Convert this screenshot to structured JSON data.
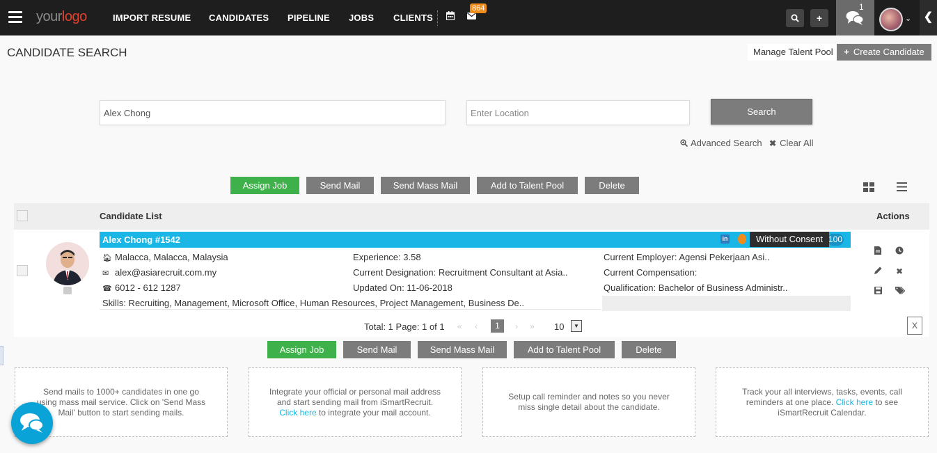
{
  "nav": {
    "logo_a": "your",
    "logo_b": "logo",
    "items": [
      "IMPORT RESUME",
      "CANDIDATES",
      "PIPELINE",
      "JOBS",
      "CLIENTS"
    ],
    "mail_badge": "864",
    "chat_count": "1"
  },
  "header": {
    "title": "CANDIDATE SEARCH",
    "manage_pool": "Manage Talent Pool",
    "create_candidate": "Create Candidate"
  },
  "search": {
    "keyword_value": "Alex Chong",
    "location_placeholder": "Enter Location",
    "button": "Search",
    "advanced": "Advanced Search",
    "clear": "Clear All"
  },
  "actions": {
    "assign_job": "Assign Job",
    "send_mail": "Send Mail",
    "send_mass_mail": "Send Mass Mail",
    "add_pool": "Add to Talent Pool",
    "delete": "Delete"
  },
  "list": {
    "title": "Candidate List",
    "actions_label": "Actions"
  },
  "candidate": {
    "name": "Alex Chong #1542",
    "tooltip": "Without Consent",
    "score": "100",
    "location": "Malacca, Malacca, Malaysia",
    "email": "alex@asiarecruit.com.my",
    "phone": "6012 - 612 1287",
    "skills": "Skills: Recruiting, Management, Microsoft Office, Human Resources, Project Management, Business De..",
    "experience": "Experience: 3.58",
    "designation": "Current Designation: Recruitment Consultant at Asia..",
    "updated": "Updated On: 11-06-2018",
    "employer": "Current Employer: Agensi Pekerjaan Asi..",
    "compensation": "Current Compensation:",
    "qualification": "Qualification: Bachelor of Business Administr.."
  },
  "pager": {
    "total": "Total: 1 Page: 1 of 1",
    "current": "1",
    "size": "10"
  },
  "cards": [
    {
      "text": "Send mails to 1000+ candidates in one go using mass mail service. Click on 'Send Mass Mail' button to start sending mails."
    },
    {
      "pre": "Integrate your official or personal mail address and start sending mail from iSmartRecruit. ",
      "link": "Click here",
      "post": " to integrate your mail account."
    },
    {
      "text": "Setup call reminder and notes so you never miss single detail about the candidate."
    },
    {
      "pre": "Track your all interviews, tasks, events, call reminders at one place. ",
      "link": "Click here",
      "post": " to see iSmartRecruit Calendar."
    }
  ],
  "colors": {
    "accent": "#1ab6e5",
    "green": "#3fb14b",
    "button_grey": "#7c7c7c",
    "topbar": "#1e1e1e"
  }
}
